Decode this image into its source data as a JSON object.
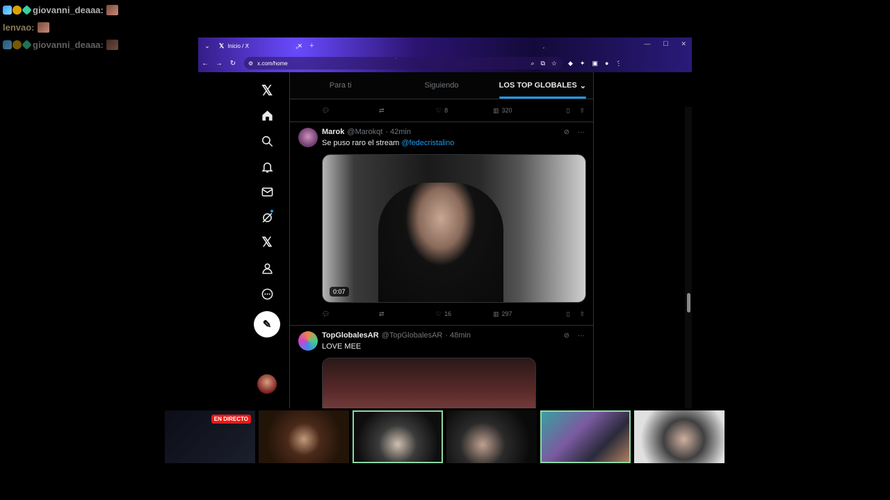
{
  "chat": [
    {
      "user": "giovanni_deaaa:",
      "badges": true
    },
    {
      "user": "lenvao:",
      "badges": false
    },
    {
      "user": "giovanni_deaaa:",
      "badges": true
    }
  ],
  "browser": {
    "tab_title": "Inicio / X",
    "tab_close": "✕",
    "new_tab": "+",
    "url": "x.com/home"
  },
  "timeline_tabs": [
    "Para ti",
    "Siguiendo",
    "LOS TOP GLOBALES"
  ],
  "active_tab": "LOS TOP GLOBALES",
  "prev_actions": {
    "likes": "8",
    "views": "320"
  },
  "tweets": [
    {
      "name": "Marok",
      "handle": "@Marokqt",
      "time": "· 42min",
      "text": "Se puso raro el stream ",
      "mention": "@fedecristalino",
      "duration": "0:07",
      "likes": "16",
      "views": "297"
    },
    {
      "name": "TopGlobalesAR",
      "handle": "@TopGlobalesAR",
      "time": "· 48min",
      "text": "LOVE MEE"
    }
  ],
  "live_badge": "EN DIRECTO",
  "colors": {
    "accent": "#1d9bf0",
    "live": "#e91916",
    "cam_highlight": "#8cd9a6"
  }
}
